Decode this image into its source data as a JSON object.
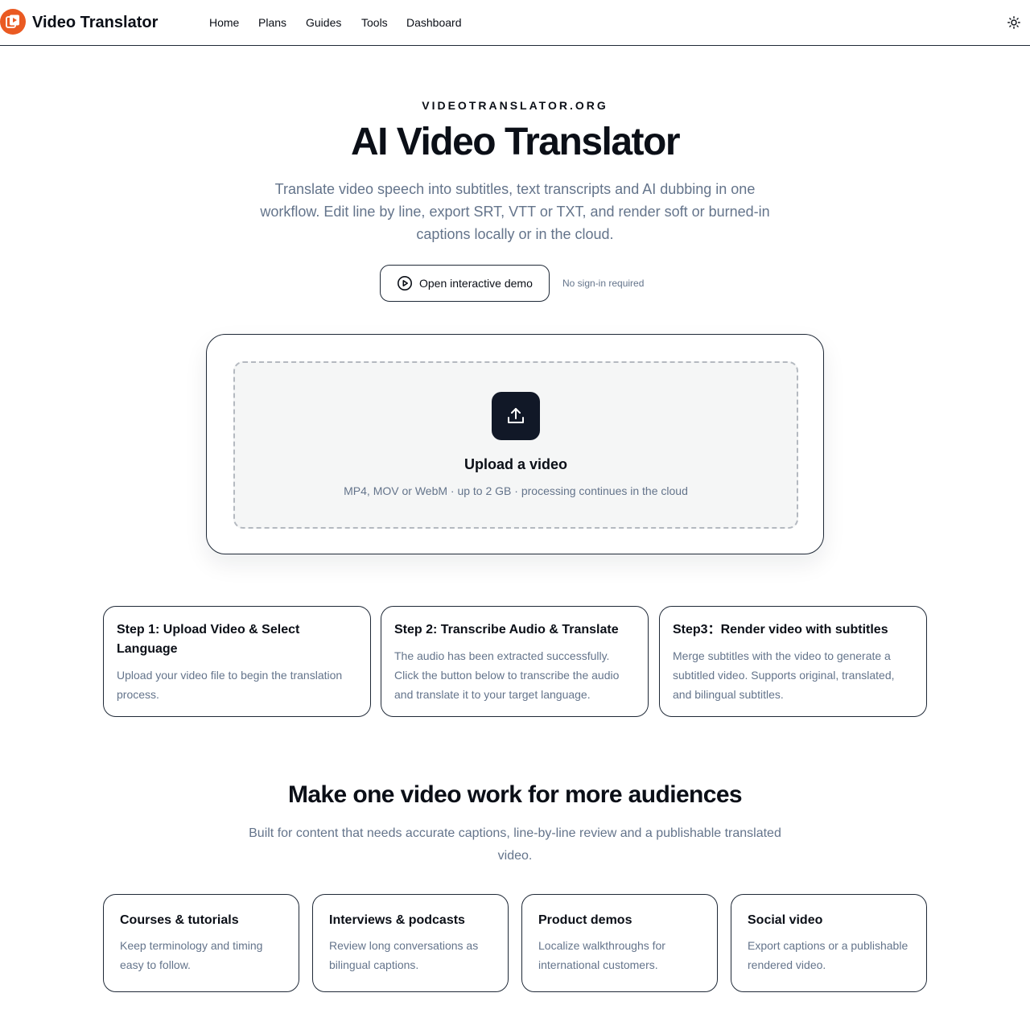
{
  "header": {
    "brand": "Video Translator",
    "nav": [
      "Home",
      "Plans",
      "Guides",
      "Tools",
      "Dashboard"
    ],
    "theme_icon": "sun-icon"
  },
  "hero": {
    "eyebrow": "VIDEOTRANSLATOR.ORG",
    "title": "AI Video Translator",
    "subtitle": "Translate video speech into subtitles, text transcripts and AI dubbing in one workflow. Edit line by line, export SRT, VTT or TXT, and render soft or burned-in captions locally or in the cloud.",
    "demo_button": "Open interactive demo",
    "demo_note": "No sign-in required"
  },
  "upload": {
    "title": "Upload a video",
    "hint": "MP4, MOV or WebM · up to 2 GB · processing continues in the cloud"
  },
  "steps": [
    {
      "title": "Step 1: Upload Video & Select Language",
      "desc": "Upload your video file to begin the translation process."
    },
    {
      "title": "Step 2: Transcribe Audio & Translate",
      "desc": "The audio has been extracted successfully. Click the button below to transcribe the audio and translate it to your target language."
    },
    {
      "title": "Step3：Render video with subtitles",
      "desc": "Merge subtitles with the video to generate a subtitled video. Supports original, translated, and bilingual subtitles."
    }
  ],
  "audiences": {
    "title": "Make one video work for more audiences",
    "subtitle": "Built for content that needs accurate captions, line-by-line review and a publishable translated video.",
    "cards": [
      {
        "title": "Courses & tutorials",
        "desc": "Keep terminology and timing easy to follow."
      },
      {
        "title": "Interviews & podcasts",
        "desc": "Review long conversations as bilingual captions."
      },
      {
        "title": "Product demos",
        "desc": "Localize walkthroughs for international customers."
      },
      {
        "title": "Social video",
        "desc": "Export captions or a publishable rendered video."
      }
    ]
  },
  "colors": {
    "brand": "#ea5a22",
    "text": "#0b0f17",
    "muted": "#64748b",
    "dark_tile": "#111827"
  }
}
